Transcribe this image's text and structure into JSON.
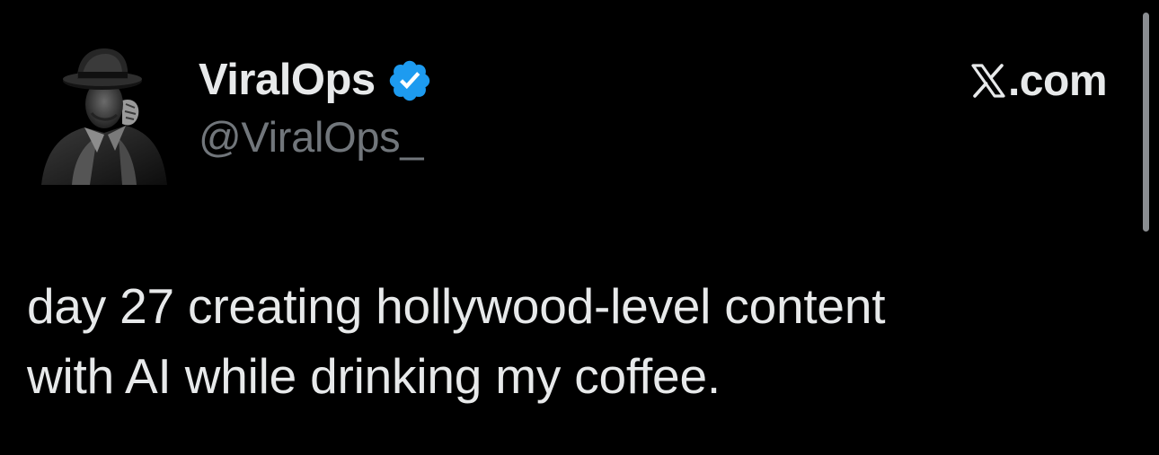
{
  "tweet": {
    "author": {
      "display_name": "ViralOps",
      "handle": "@ViralOps_",
      "verified": true,
      "avatar_icon": "fedora-silhouette-avatar-icon"
    },
    "source": {
      "icon": "x-logo-icon",
      "label": ".com"
    },
    "text_lines": [
      "day 27 creating hollywood-level content",
      "with AI while drinking my coffee."
    ]
  },
  "colors": {
    "background": "#000000",
    "primary_text": "#e7e9ea",
    "secondary_text": "#71767b",
    "verified_blue": "#1d9bf0",
    "scrollbar": "#8a8d91"
  }
}
